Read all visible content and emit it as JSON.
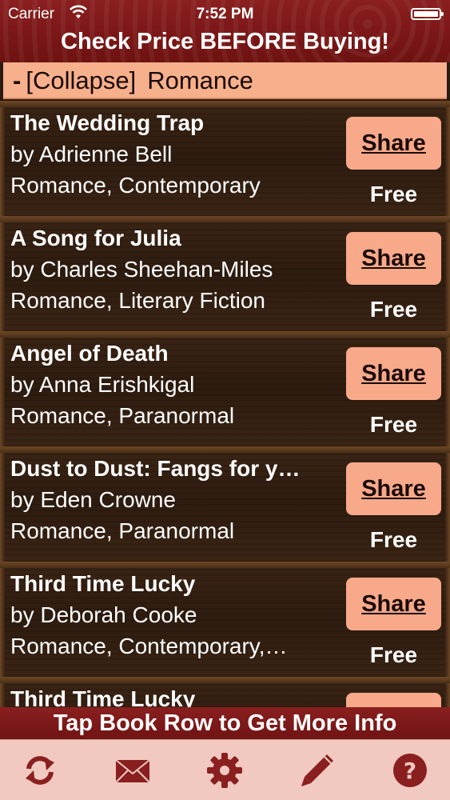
{
  "status_bar": {
    "carrier": "Carrier",
    "time": "7:52 PM"
  },
  "nav": {
    "title": "Check Price BEFORE Buying!"
  },
  "category": {
    "toggle_prefix": "-",
    "toggle_label": "[Collapse]",
    "name": "Romance"
  },
  "books": [
    {
      "title": "The Wedding Trap",
      "author": "by Adrienne Bell",
      "genre": "Romance, Contemporary",
      "share_label": "Share",
      "price": "Free"
    },
    {
      "title": "A Song for Julia",
      "author": "by Charles Sheehan-Miles",
      "genre": "Romance, Literary Fiction",
      "share_label": "Share",
      "price": "Free"
    },
    {
      "title": "Angel of Death",
      "author": "by Anna Erishkigal",
      "genre": "Romance, Paranormal",
      "share_label": "Share",
      "price": "Free"
    },
    {
      "title": "Dust to Dust: Fangs for y…",
      "author": "by Eden Crowne",
      "genre": "Romance, Paranormal",
      "share_label": "Share",
      "price": "Free"
    },
    {
      "title": "Third Time Lucky",
      "author": "by Deborah Cooke",
      "genre": "Romance, Contemporary,…",
      "share_label": "Share",
      "price": "Free"
    },
    {
      "title": "Third Time Lucky",
      "author": "",
      "genre": "",
      "share_label": "",
      "price": ""
    }
  ],
  "footer": {
    "hint": "Tap Book Row to Get More Info"
  },
  "tabs": [
    {
      "icon": "refresh-icon"
    },
    {
      "icon": "mail-icon"
    },
    {
      "icon": "gear-icon"
    },
    {
      "icon": "pencil-icon"
    },
    {
      "icon": "help-icon"
    }
  ],
  "colors": {
    "header": "#7a1616",
    "category_bar": "#f7b08c",
    "share_button": "#f7a98a",
    "tab_bar": "#f1c9c0",
    "tab_icon": "#8a1f1f"
  }
}
